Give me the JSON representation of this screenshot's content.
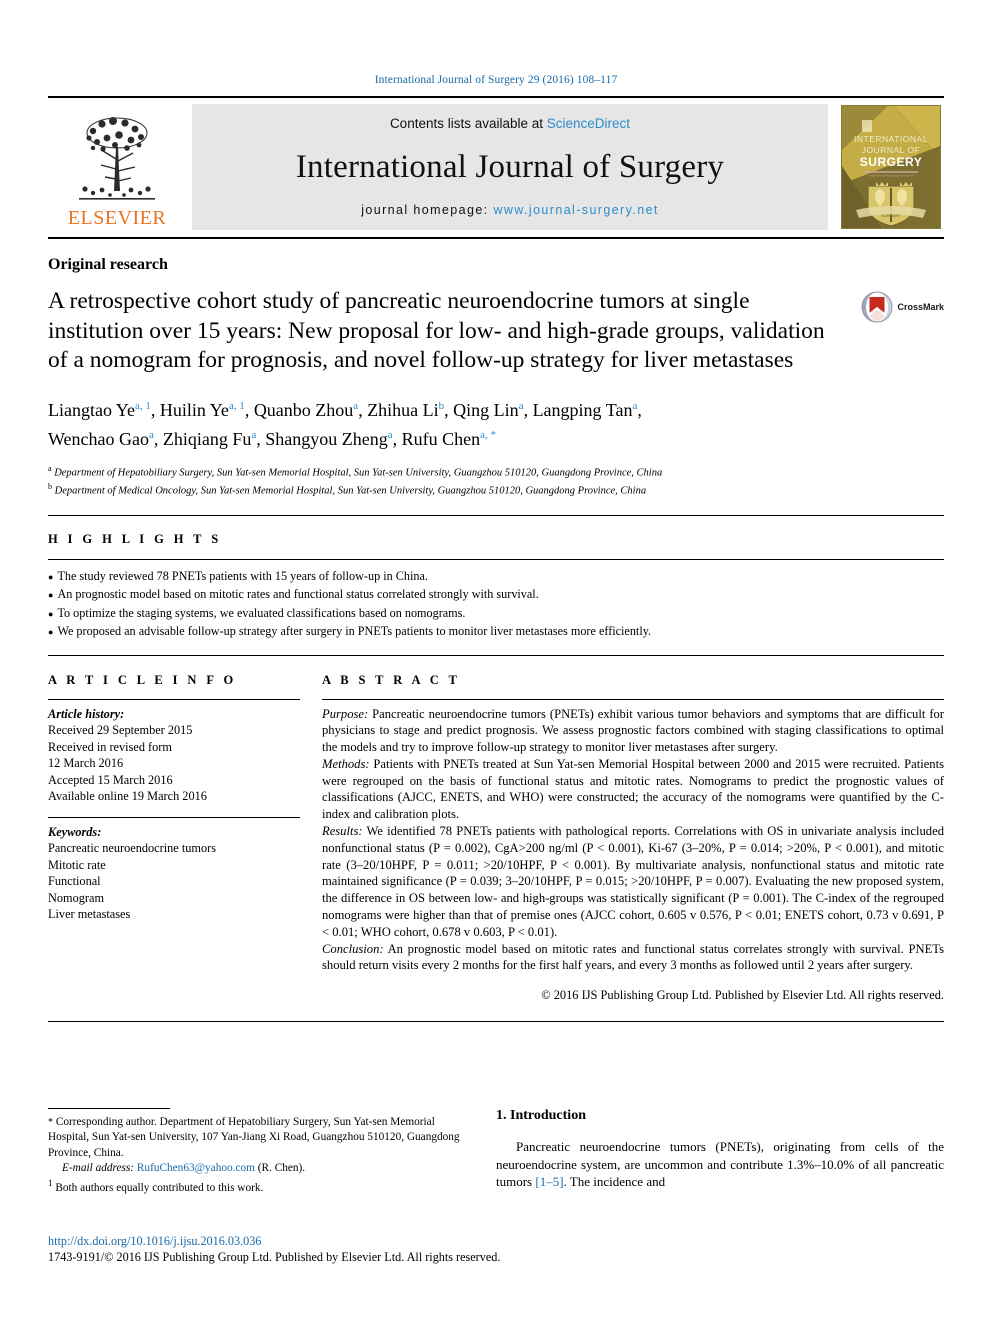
{
  "running_head": "International Journal of Surgery 29 (2016) 108–117",
  "banner": {
    "contents_prefix": "Contents lists available at ",
    "sciencedirect": "ScienceDirect",
    "journal_name": "International Journal of Surgery",
    "homepage_prefix": "journal homepage: ",
    "homepage_url": "www.journal-surgery.net",
    "publisher_wordmark": "ELSEVIER",
    "cover_title_line1": "INTERNATIONAL",
    "cover_title_line2": "JOURNAL OF",
    "cover_title_line3": "SURGERY",
    "colors": {
      "link_blue": "#2b8ccc",
      "elsevier_orange": "#e87422",
      "banner_gray": "#e6e6e6",
      "cover_gold": "#b9a23c"
    }
  },
  "article": {
    "type": "Original research",
    "title": "A retrospective cohort study of pancreatic neuroendocrine tumors at single institution over 15 years: New proposal for low- and high-grade groups, validation of a nomogram for prognosis, and novel follow-up strategy for liver metastases",
    "crossmark_label": "CrossMark",
    "authors_line1": "Liangtao Ye a, 1, Huilin Ye a, 1, Quanbo Zhou a, Zhihua Li b, Qing Lin a, Langping Tan a,",
    "authors_line2": "Wenchao Gao a, Zhiqiang Fu a, Shangyou Zheng a, Rufu Chen a, *",
    "affiliation_a": "Department of Hepatobiliary Surgery, Sun Yat-sen Memorial Hospital, Sun Yat-sen University, Guangzhou 510120, Guangdong Province, China",
    "affiliation_b": "Department of Medical Oncology, Sun Yat-sen Memorial Hospital, Sun Yat-sen University, Guangzhou 510120, Guangdong Province, China"
  },
  "highlights": {
    "label": "H I G H L I G H T S",
    "items": [
      "The study reviewed 78 PNETs patients with 15 years of follow-up in China.",
      "An prognostic model based on mitotic rates and functional status correlated strongly with survival.",
      "To optimize the staging systems, we evaluated classifications based on nomograms.",
      "We proposed an advisable follow-up strategy after surgery in PNETs patients to monitor liver metastases more efficiently."
    ]
  },
  "article_info": {
    "label": "A R T I C L E  I N F O",
    "history_label": "Article history:",
    "history": [
      "Received 29 September 2015",
      "Received in revised form",
      "12 March 2016",
      "Accepted 15 March 2016",
      "Available online 19 March 2016"
    ],
    "keywords_label": "Keywords:",
    "keywords": [
      "Pancreatic neuroendocrine tumors",
      "Mitotic rate",
      "Functional",
      "Nomogram",
      "Liver metastases"
    ]
  },
  "abstract": {
    "label": "A B S T R A C T",
    "purpose_head": "Purpose:",
    "purpose_text": " Pancreatic neuroendocrine tumors (PNETs) exhibit various tumor behaviors and symptoms that are difficult for physicians to stage and predict prognosis. We assess prognostic factors combined with staging classifications to optimal the models and try to improve follow-up strategy to monitor liver metastases after surgery.",
    "methods_head": "Methods:",
    "methods_text": " Patients with PNETs treated at Sun Yat-sen Memorial Hospital between 2000 and 2015 were recruited. Patients were regrouped on the basis of functional status and mitotic rates. Nomograms to predict the prognostic values of classifications (AJCC, ENETS, and WHO) were constructed; the accuracy of the nomograms were quantified by the C-index and calibration plots.",
    "results_head": "Results:",
    "results_text": " We identified 78 PNETs patients with pathological reports. Correlations with OS in univariate analysis included nonfunctional status (P = 0.002), CgA>200 ng/ml (P < 0.001), Ki-67 (3–20%, P = 0.014; >20%, P < 0.001), and mitotic rate (3–20/10HPF, P = 0.011; >20/10HPF, P < 0.001). By multivariate analysis, nonfunctional status and mitotic rate maintained significance (P = 0.039; 3–20/10HPF, P = 0.015; >20/10HPF, P = 0.007). Evaluating the new proposed system, the difference in OS between low- and high-groups was statistically significant (P = 0.001). The C-index of the regrouped nomograms were higher than that of premise ones (AJCC cohort, 0.605 v 0.576, P < 0.01; ENETS cohort, 0.73 v 0.691, P < 0.01; WHO cohort, 0.678 v 0.603, P < 0.01).",
    "conclusion_head": "Conclusion:",
    "conclusion_text": " An prognostic model based on mitotic rates and functional status correlates strongly with survival. PNETs should return visits every 2 months for the first half years, and every 3 months as followed until 2 years after surgery.",
    "copyright": "© 2016 IJS Publishing Group Ltd. Published by Elsevier Ltd. All rights reserved."
  },
  "footnote": {
    "corresponding_mark": "*",
    "corresponding_text": " Corresponding author. Department of Hepatobiliary Surgery, Sun Yat-sen Memorial Hospital, Sun Yat-sen University, 107 Yan-Jiang Xi Road, Guangzhou 510120, Guangdong Province, China.",
    "email_label": "E-mail address:",
    "email": "RufuChen63@yahoo.com",
    "email_suffix": " (R. Chen).",
    "equal_contrib_mark": "1",
    "equal_contrib_text": " Both authors equally contributed to this work."
  },
  "introduction": {
    "heading": "1. Introduction",
    "paragraph_part1": "Pancreatic neuroendocrine tumors (PNETs), originating from cells of the neuroendocrine system, are uncommon and contribute 1.3%–10.0% of all pancreatic tumors ",
    "citation": "[1–5]",
    "paragraph_part2": ". The incidence and"
  },
  "page_footer": {
    "doi": "http://dx.doi.org/10.1016/j.ijsu.2016.03.036",
    "issn_line": "1743-9191/© 2016 IJS Publishing Group Ltd. Published by Elsevier Ltd. All rights reserved."
  }
}
